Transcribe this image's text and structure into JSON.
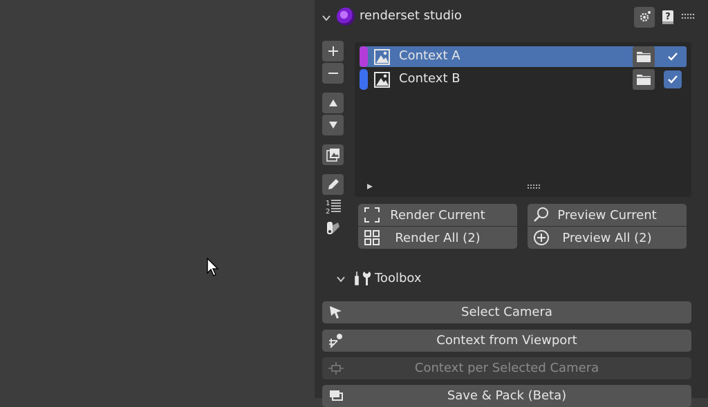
{
  "panel": {
    "title": "renderset studio"
  },
  "contexts": {
    "items": [
      {
        "label": "Context A",
        "color": "#b43cd8",
        "selected": true,
        "checked": true
      },
      {
        "label": "Context B",
        "color": "#3c6ef0",
        "selected": false,
        "checked": true
      }
    ]
  },
  "render": {
    "render_current": "Render Current",
    "render_all": "Render All (2)",
    "preview_current": "Preview Current",
    "preview_all": "Preview All (2)"
  },
  "toolbox": {
    "title": "Toolbox",
    "select_camera": "Select Camera",
    "context_from_viewport": "Context from Viewport",
    "context_per_selected_camera": "Context per Selected Camera",
    "save_pack": "Save & Pack (Beta)"
  },
  "colors": {
    "selection": "#4a72b0",
    "panel_bg": "#303030",
    "viewport_bg": "#3d3d3d"
  }
}
